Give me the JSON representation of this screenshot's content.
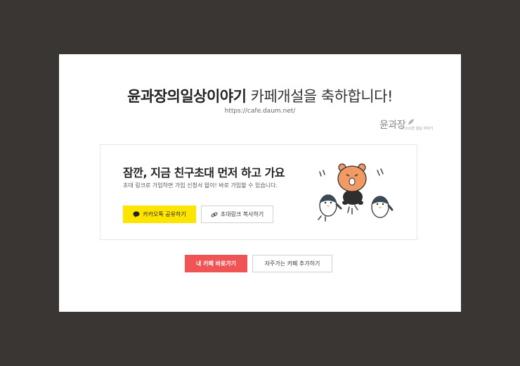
{
  "header": {
    "cafe_name": "윤과장의일상이야기",
    "title_suffix": " 카페개설을 축하합니다!",
    "url": "https://cafe.daum.net/"
  },
  "watermark": {
    "main": "윤과장",
    "sub": "의 소소한 일상 이야기"
  },
  "invite": {
    "title": "잠깐, 지금 친구초대 먼저 하고 가요",
    "description": "초대 링크로 가입하면 가입 신청서 없이! 바로 가입할 수 있습니다.",
    "kakao_share_label": "카카오톡 공유하기",
    "copy_link_label": "초대링크 복사하기"
  },
  "actions": {
    "go_to_cafe_label": "내 카페 바로가기",
    "add_favorite_label": "자주가는 카페 추가하기"
  },
  "colors": {
    "backdrop": "#3a3634",
    "kakao_yellow": "#fee500",
    "primary_red": "#f05454"
  },
  "icons": {
    "kakao": "speech-bubble-icon",
    "copy": "link-icon"
  }
}
